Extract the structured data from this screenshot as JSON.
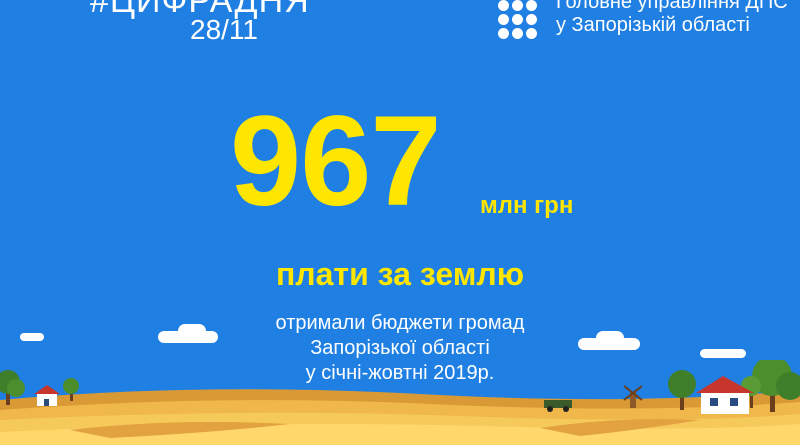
{
  "header": {
    "hashtag": "#ЦИФРАДНЯ",
    "date": "28/11"
  },
  "organization": {
    "line1": "Головне управління ДПС",
    "line2": "у Запорізькій області",
    "logo_icon": "nine-dot-grid-logo"
  },
  "main": {
    "big_number": "967",
    "unit": "млн грн",
    "subtitle": "плати за землю",
    "description_lines": [
      "отримали бюджети громад",
      "Запорізької області",
      "у січні-жовтні 2019р."
    ]
  },
  "colors": {
    "background": "#1f7fe3",
    "accent_yellow": "#ffe600",
    "text_white": "#ffffff",
    "field_gold": "#f2b84b",
    "tree_green": "#4c8d2c"
  }
}
